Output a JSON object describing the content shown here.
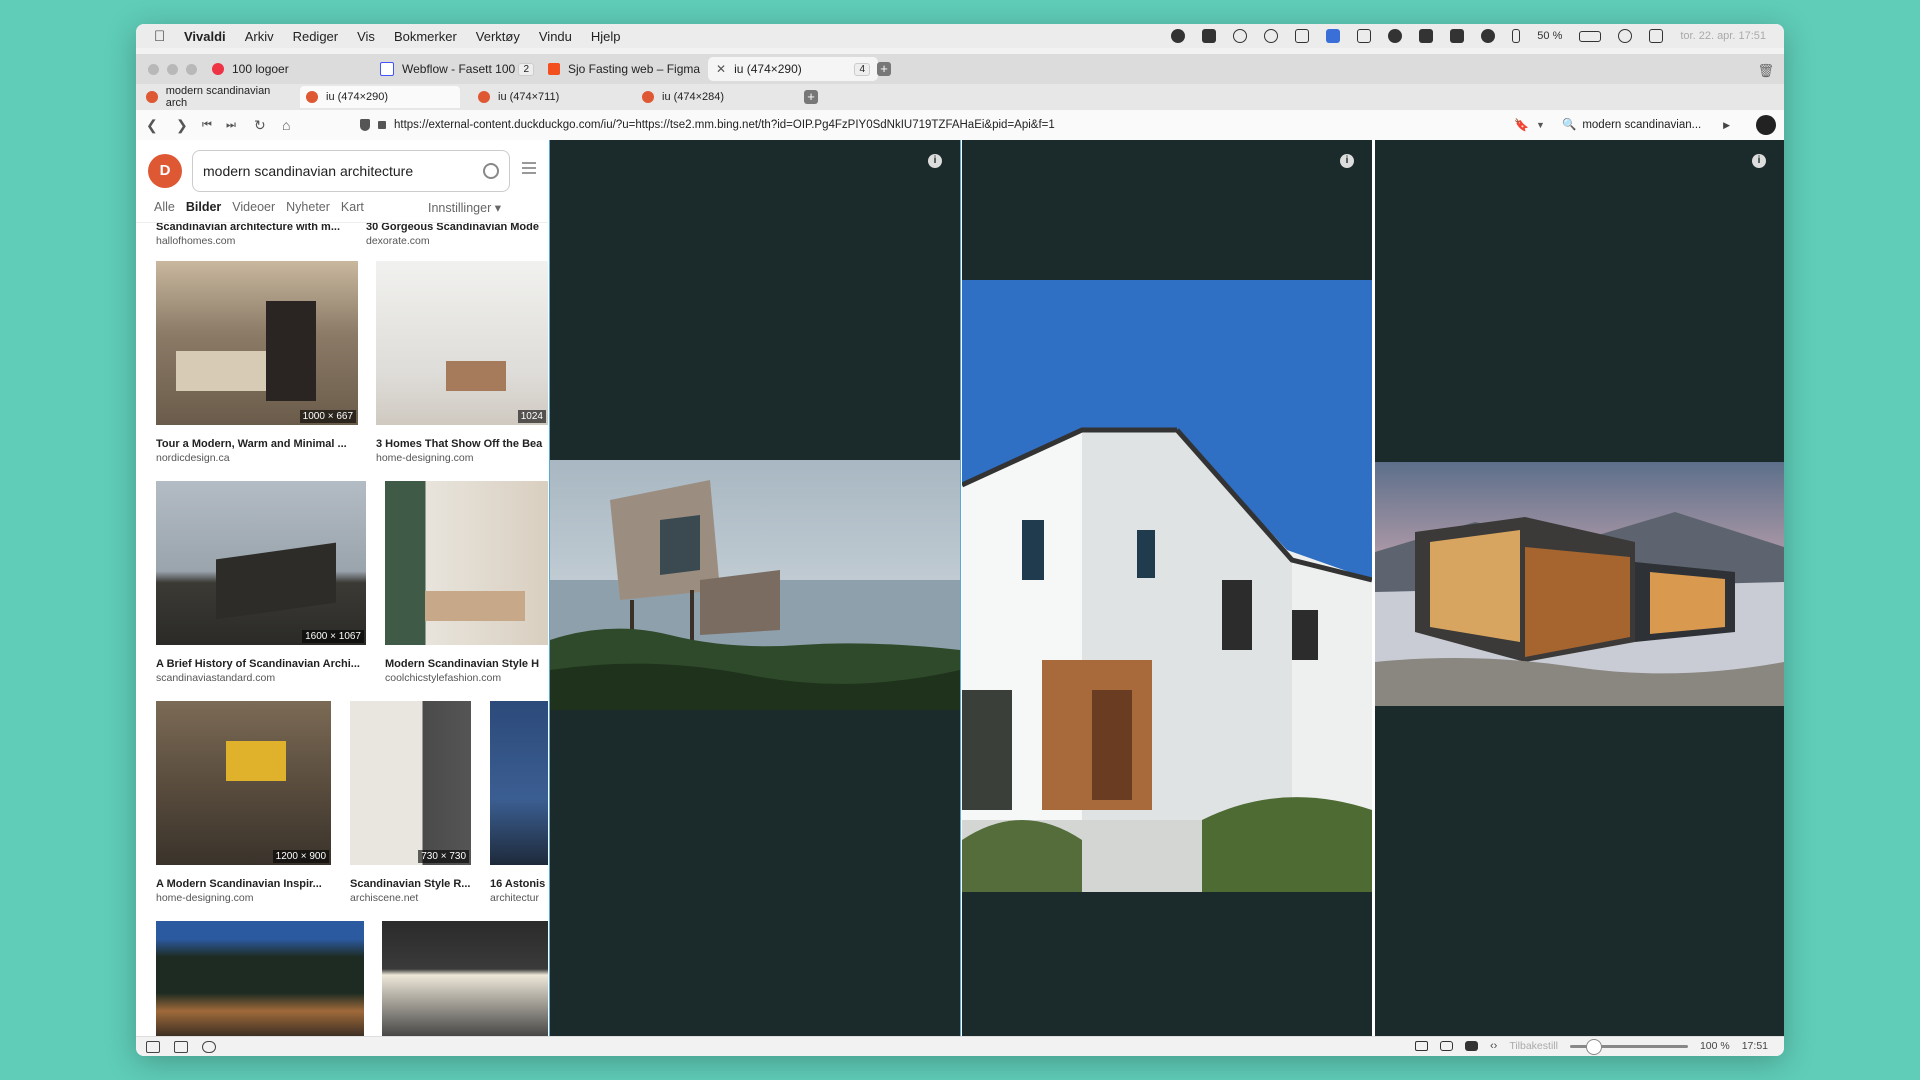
{
  "menubar": {
    "app": "Vivaldi",
    "items": [
      "Arkiv",
      "Rediger",
      "Vis",
      "Bokmerker",
      "Verktøy",
      "Vindu",
      "Hjelp"
    ],
    "battery": "50 %",
    "datetime": "tor. 22. apr.  17:51"
  },
  "tabs_top": [
    {
      "label": "100 logoer",
      "count": ""
    },
    {
      "label": "Webflow - Fasett 100",
      "count": "2"
    },
    {
      "label": "Sjo Fasting web – Figma",
      "count": ""
    },
    {
      "label": "iu (474×290)",
      "count": "4"
    }
  ],
  "tabs_sub": [
    {
      "label": "modern scandinavian arch"
    },
    {
      "label": "iu (474×290)"
    },
    {
      "label": "iu (474×711)"
    },
    {
      "label": "iu (474×284)"
    }
  ],
  "address": {
    "url": "https://external-content.duckduckgo.com/iu/?u=https://tse2.mm.bing.net/th?id=OIP.Pg4FzPIY0SdNkIU719TZFAHaEi&pid=Api&f=1",
    "search": "modern scandinavian..."
  },
  "search": {
    "logo": "D",
    "query": "modern scandinavian architecture",
    "filters": [
      "Alle",
      "Bilder",
      "Videoer",
      "Nyheter",
      "Kart"
    ],
    "active_filter": "Bilder",
    "settings": "Innstillinger ▾"
  },
  "results": [
    {
      "title": "Scandinavian architecture with m...",
      "source": "hallofhomes.com",
      "dims": ""
    },
    {
      "title": "30 Gorgeous Scandinavian Mode",
      "source": "dexorate.com",
      "dims": ""
    },
    {
      "title": "Tour a Modern, Warm and Minimal ...",
      "source": "nordicdesign.ca",
      "dims": "1000 × 667"
    },
    {
      "title": "3 Homes That Show Off the Bea",
      "source": "home-designing.com",
      "dims": "1024"
    },
    {
      "title": "A Brief History of Scandinavian Archi...",
      "source": "scandinaviastandard.com",
      "dims": "1600 × 1067"
    },
    {
      "title": "Modern Scandinavian Style H",
      "source": "coolchicstylefashion.com",
      "dims": ""
    },
    {
      "title": "A Modern Scandinavian Inspir...",
      "source": "home-designing.com",
      "dims": "1200 × 900"
    },
    {
      "title": "Scandinavian Style R...",
      "source": "archiscene.net",
      "dims": "730 × 730"
    },
    {
      "title": "16 Astonis",
      "source": "architectur",
      "dims": ""
    }
  ],
  "panels": [
    {
      "info": "i"
    },
    {
      "info": "i"
    },
    {
      "info": "i"
    }
  ],
  "statusbar": {
    "reset": "Tilbakestill",
    "zoom": "100 %",
    "zoom_level": 0.15,
    "time": "17:51"
  },
  "colors": {
    "background": "#5fcdb8",
    "panel": "#1b2a2a",
    "ddg": "#de5833"
  }
}
